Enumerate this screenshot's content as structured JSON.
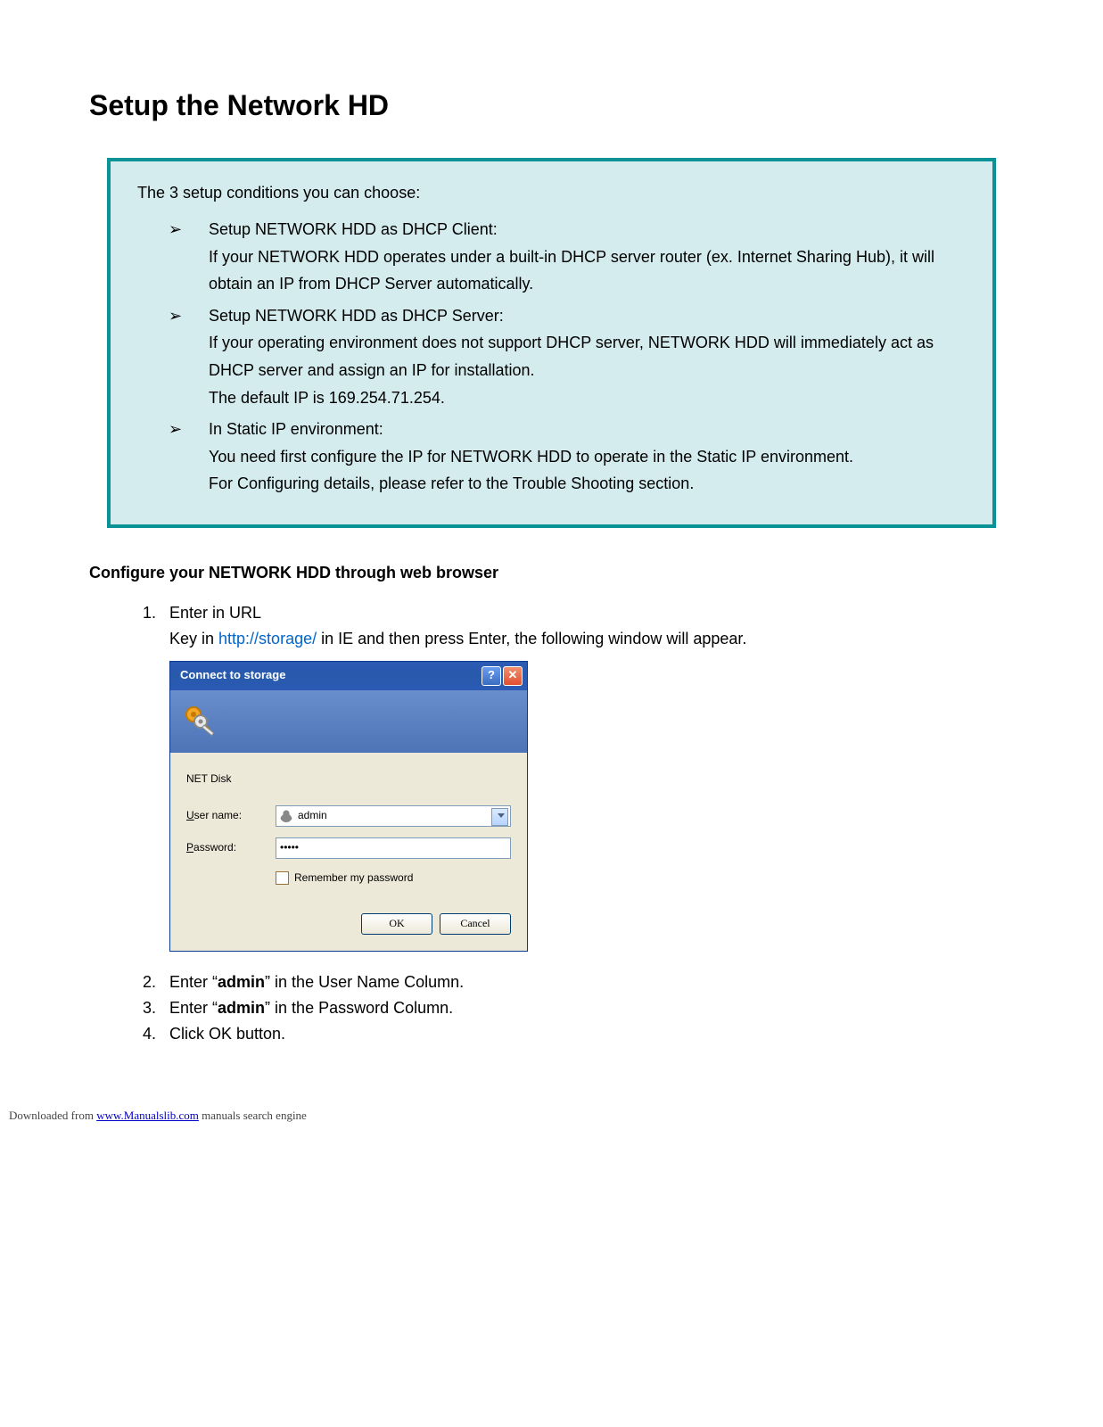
{
  "page_title": "Setup the Network HD",
  "info_box": {
    "intro": "The 3 setup conditions you can choose:",
    "items": [
      {
        "title": "Setup NETWORK HDD as DHCP Client:",
        "body": "If your NETWORK HDD operates under a built-in DHCP server router (ex. Internet Sharing Hub), it will obtain an IP from DHCP Server automatically."
      },
      {
        "title": "Setup NETWORK HDD as DHCP Server:",
        "body": "If your operating environment does not support DHCP server, NETWORK HDD will immediately act as DHCP server and assign an IP for installation.",
        "body2": "The default IP is 169.254.71.254."
      },
      {
        "title": "In Static IP environment:",
        "body": "You need first configure the IP for NETWORK HDD to operate in the Static IP environment.",
        "body2": "For Configuring details, please refer to the Trouble Shooting section."
      }
    ]
  },
  "subhead": "Configure your NETWORK HDD through web browser",
  "steps": {
    "s1_title": "Enter in URL",
    "s1_pre": "Key in ",
    "s1_link": "http://storage/",
    "s1_post": " in IE and then press Enter, the following window will appear.",
    "s2_pre": "Enter “",
    "s2_b": "admin",
    "s2_post": "” in the User Name Column.",
    "s3_pre": "Enter “",
    "s3_b": "admin",
    "s3_post": "” in the Password Column.",
    "s4": "Click OK button."
  },
  "dialog": {
    "title": "Connect to storage",
    "netdisk": "NET Disk",
    "username_label_u": "U",
    "username_label_rest": "ser name:",
    "username_value": "admin",
    "password_label_p": "P",
    "password_label_rest": "assword:",
    "password_value": "•••••",
    "remember_r": "R",
    "remember_rest": "emember my password",
    "ok": "OK",
    "cancel": "Cancel"
  },
  "footer": {
    "pre": "Downloaded from ",
    "link": "www.Manualslib.com",
    "post": " manuals search engine"
  }
}
